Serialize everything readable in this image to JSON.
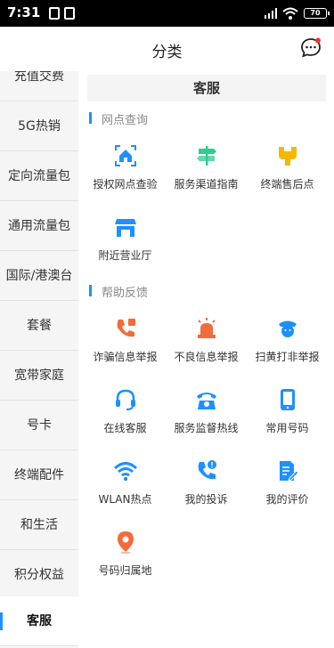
{
  "status": {
    "time": "7:31",
    "battery": "70"
  },
  "header": {
    "title": "分类"
  },
  "sidebar": {
    "items": [
      {
        "label": "充值交费"
      },
      {
        "label": "5G热销"
      },
      {
        "label": "定向流量包"
      },
      {
        "label": "通用流量包"
      },
      {
        "label": "国际/港澳台"
      },
      {
        "label": "套餐"
      },
      {
        "label": "宽带家庭"
      },
      {
        "label": "号卡"
      },
      {
        "label": "终端配件"
      },
      {
        "label": "和生活"
      },
      {
        "label": "积分权益"
      },
      {
        "label": "客服"
      }
    ],
    "active_index": 11
  },
  "main": {
    "title": "客服",
    "sections": [
      {
        "title": "网点查询",
        "items": [
          {
            "label": "授权网点查验",
            "icon": "home-scan-icon"
          },
          {
            "label": "服务渠道指南",
            "icon": "signpost-icon"
          },
          {
            "label": "终端售后点",
            "icon": "wrench-icon"
          },
          {
            "label": "附近营业厅",
            "icon": "store-icon"
          }
        ]
      },
      {
        "title": "帮助反馈",
        "items": [
          {
            "label": "诈骗信息举报",
            "icon": "phone-warning-icon"
          },
          {
            "label": "不良信息举报",
            "icon": "alarm-light-icon"
          },
          {
            "label": "扫黄打非举报",
            "icon": "police-icon"
          },
          {
            "label": "在线客服",
            "icon": "headset-icon"
          },
          {
            "label": "服务监督热线",
            "icon": "telephone-icon"
          },
          {
            "label": "常用号码",
            "icon": "mobile-phone-icon"
          },
          {
            "label": "WLAN热点",
            "icon": "wifi-icon"
          },
          {
            "label": "我的投诉",
            "icon": "phone-alert-icon"
          },
          {
            "label": "我的评价",
            "icon": "document-edit-icon"
          },
          {
            "label": "号码归属地",
            "icon": "location-pin-icon"
          }
        ]
      }
    ]
  },
  "colors": {
    "accent": "#1e90ff",
    "orange": "#f26b3a",
    "yellow": "#f5b800",
    "green": "#2ecc8f"
  }
}
